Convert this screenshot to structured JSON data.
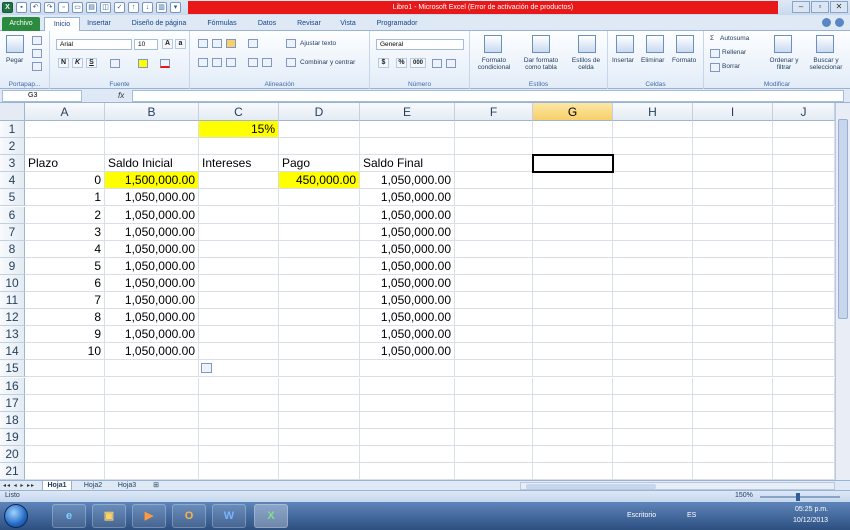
{
  "window": {
    "title": "Libro1 - Microsoft Excel (Error de activación de productos)",
    "controls": [
      "–",
      "▫",
      "✕"
    ]
  },
  "ribbon_tabs": [
    "Archivo",
    "Inicio",
    "Insertar",
    "Diseño de página",
    "Fórmulas",
    "Datos",
    "Revisar",
    "Vista",
    "Programador"
  ],
  "active_tab": "Inicio",
  "ribbon": {
    "clipboard": {
      "label": "Portapap...",
      "paste": "Pegar"
    },
    "font": {
      "label": "Fuente",
      "name": "Arial",
      "size": "10",
      "bold": "N",
      "italic": "K",
      "underline": "S"
    },
    "alignment": {
      "label": "Alineación",
      "wrap": "Ajustar texto",
      "merge": "Combinar y centrar"
    },
    "number": {
      "label": "Número",
      "format": "General",
      "currency": "$",
      "percent": "%",
      "thousands": "000"
    },
    "styles": {
      "label": "Estilos",
      "conditional": "Formato condicional",
      "table": "Dar formato como tabla",
      "cell_styles": "Estilos de celda"
    },
    "cells": {
      "label": "Celdas",
      "insert": "Insertar",
      "delete": "Eliminar",
      "format": "Formato"
    },
    "editing": {
      "label": "Modificar",
      "autosum": "Autosuma",
      "fill": "Rellenar",
      "clear": "Borrar",
      "sort": "Ordenar y filtrar",
      "find": "Buscar y seleccionar"
    }
  },
  "formula_bar": {
    "name_box": "G3",
    "fx": "fx",
    "value": ""
  },
  "columns": [
    "A",
    "B",
    "C",
    "D",
    "E",
    "F",
    "G",
    "H",
    "I",
    "J"
  ],
  "selected_column": "G",
  "rows": [
    "1",
    "2",
    "3",
    "4",
    "5",
    "6",
    "7",
    "8",
    "9",
    "10",
    "11",
    "12",
    "13",
    "14",
    "15",
    "16",
    "17",
    "18",
    "19",
    "20",
    "21"
  ],
  "cells": {
    "C1": "15%",
    "A3": "Plazo",
    "B3": "Saldo Inicial",
    "C3": "Intereses",
    "D3": "Pago",
    "E3": "Saldo Final",
    "A4": "0",
    "B4": "1,500,000.00",
    "D4": "450,000.00",
    "E4": "1,050,000.00",
    "A5": "1",
    "B5": "1,050,000.00",
    "E5": "1,050,000.00",
    "A6": "2",
    "B6": "1,050,000.00",
    "E6": "1,050,000.00",
    "A7": "3",
    "B7": "1,050,000.00",
    "E7": "1,050,000.00",
    "A8": "4",
    "B8": "1,050,000.00",
    "E8": "1,050,000.00",
    "A9": "5",
    "B9": "1,050,000.00",
    "E9": "1,050,000.00",
    "A10": "6",
    "B10": "1,050,000.00",
    "E10": "1,050,000.00",
    "A11": "7",
    "B11": "1,050,000.00",
    "E11": "1,050,000.00",
    "A12": "8",
    "B12": "1,050,000.00",
    "E12": "1,050,000.00",
    "A13": "9",
    "B13": "1,050,000.00",
    "E13": "1,050,000.00",
    "A14": "10",
    "B14": "1,050,000.00",
    "E14": "1,050,000.00"
  },
  "highlight_color": "#ffff00",
  "sheet_tabs": [
    "Hoja1",
    "Hoja2",
    "Hoja3"
  ],
  "active_sheet": "Hoja1",
  "status": {
    "mode": "Listo",
    "zoom": "150%"
  },
  "taskbar": {
    "desktop": "Escritorio",
    "lang": "ES",
    "time": "05:25 p.m.",
    "date": "10/12/2013",
    "apps": [
      "e",
      "▣",
      "▶",
      "O",
      "W",
      "X"
    ]
  }
}
